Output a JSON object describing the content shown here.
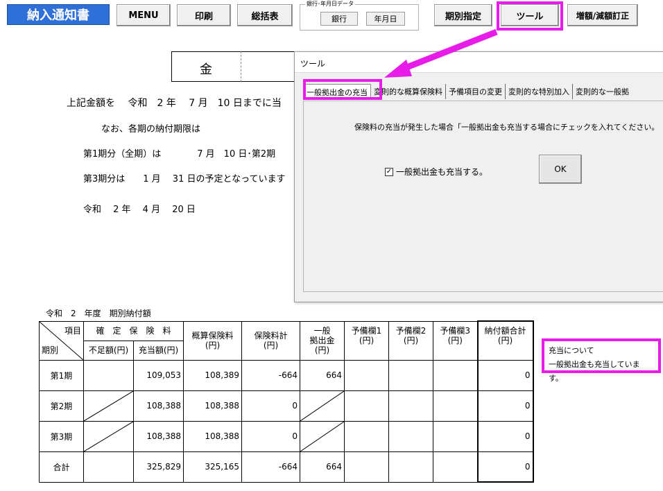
{
  "toolbar": {
    "title": "納入通知書",
    "menu": "MENU",
    "print": "印刷",
    "summary": "総括表",
    "group_title": "銀行･年月日データ",
    "bank": "銀行",
    "date": "年月日",
    "period": "期別指定",
    "tool": "ツール",
    "adjust": "増額/減額訂正"
  },
  "document": {
    "kin": "金",
    "line1": "上記金額を　 令和　2 年　 7 月　10 日までに当",
    "line2": "なお、各期の納付期限は",
    "line3": "第1期分（全期）は　　　　7 月　10 日･第2期",
    "line4": "第3期分は　　1 月　 31 日の予定となっています",
    "line5": "令和　 2 年　 4 月　 20 日"
  },
  "dialog": {
    "title": "ツール",
    "tabs": [
      "一般拠出金の充当",
      "変則的な概算保険料",
      "予備項目の変更",
      "変則的な特別加入",
      "変則的な一般拠"
    ],
    "message": "保険料の充当が発生した場合「一般拠出金も充当する場合にチェックを入れてください。",
    "checkbox_label": "一般拠出金も充当する。",
    "checkbox_checked": true,
    "ok": "OK"
  },
  "table": {
    "caption": "令和　2　年度　期別納付額",
    "head": {
      "item": "項目",
      "period": "期別",
      "kakutei": "確　定　保　険　料",
      "fusoku": "不足額(円)",
      "juto": "充当額(円)",
      "gaisan": "概算保険料\n(円)",
      "hokenkei": "保険料計\n(円)",
      "ippan": "一般\n拠出金\n(円)",
      "yobi1": "予備欄1\n(円)",
      "yobi2": "予備欄2\n(円)",
      "yobi3": "予備欄3\n(円)",
      "nofu": "納付額合計\n(円)"
    },
    "rows": [
      {
        "label": "第1期",
        "fusoku": "",
        "juto": "109,053",
        "gaisan": "108,389",
        "hokenkei": "-664",
        "ippan": "664",
        "nofu": "0"
      },
      {
        "label": "第2期",
        "fusoku": "",
        "juto": "108,388",
        "gaisan": "108,388",
        "hokenkei": "0",
        "ippan": "",
        "nofu": "0"
      },
      {
        "label": "第3期",
        "fusoku": "",
        "juto": "108,388",
        "gaisan": "108,388",
        "hokenkei": "0",
        "ippan": "",
        "nofu": "0"
      },
      {
        "label": "合計",
        "fusoku": "",
        "juto": "325,829",
        "gaisan": "325,165",
        "hokenkei": "-664",
        "ippan": "664",
        "nofu": "0"
      }
    ]
  },
  "note": {
    "line1": "充当について",
    "line2": "一般拠出金も充当しています。"
  },
  "colors": {
    "highlight": "#e81ce8",
    "title_button": "#2f6fd8"
  }
}
